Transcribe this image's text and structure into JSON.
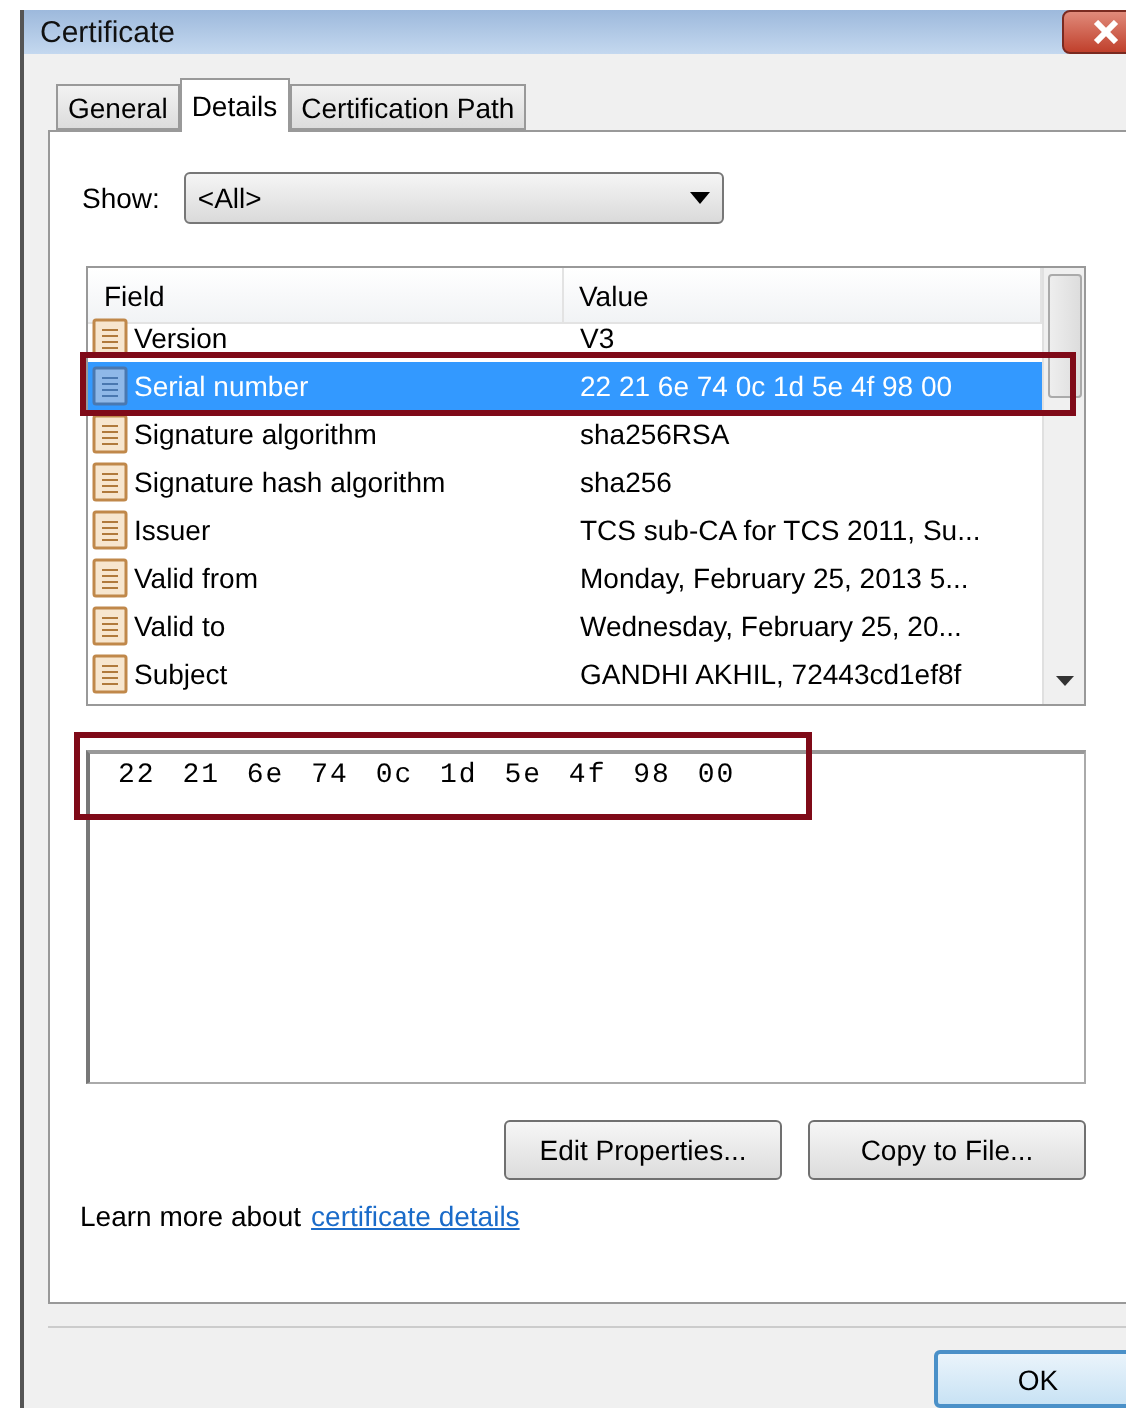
{
  "window": {
    "title": "Certificate"
  },
  "tabs": [
    {
      "label": "General",
      "selected": false
    },
    {
      "label": "Details",
      "selected": true
    },
    {
      "label": "Certification Path",
      "selected": false
    }
  ],
  "show": {
    "label": "Show:",
    "value": "<All>"
  },
  "list": {
    "columns": [
      "Field",
      "Value"
    ],
    "rows": [
      {
        "field": "Version",
        "value": "V3",
        "selected": false,
        "highlighted": false
      },
      {
        "field": "Serial number",
        "value": "22 21 6e 74 0c 1d 5e 4f 98 00",
        "selected": true,
        "highlighted": true
      },
      {
        "field": "Signature algorithm",
        "value": "sha256RSA",
        "selected": false,
        "highlighted": false
      },
      {
        "field": "Signature hash algorithm",
        "value": "sha256",
        "selected": false,
        "highlighted": false
      },
      {
        "field": "Issuer",
        "value": "TCS sub-CA for TCS 2011, Su...",
        "selected": false,
        "highlighted": false
      },
      {
        "field": "Valid from",
        "value": "Monday, February 25, 2013 5...",
        "selected": false,
        "highlighted": false
      },
      {
        "field": "Valid to",
        "value": "Wednesday, February 25, 20...",
        "selected": false,
        "highlighted": false
      },
      {
        "field": "Subject",
        "value": "GANDHI AKHIL, 72443cd1ef8f",
        "selected": false,
        "highlighted": false
      }
    ]
  },
  "detail": {
    "value": "22 21 6e 74 0c 1d 5e 4f 98 00",
    "highlighted": true
  },
  "buttons": [
    "Edit Properties...",
    "Copy to File..."
  ],
  "learn_more": {
    "text": "Learn more about",
    "link": "certificate details"
  },
  "ok_button": "OK"
}
